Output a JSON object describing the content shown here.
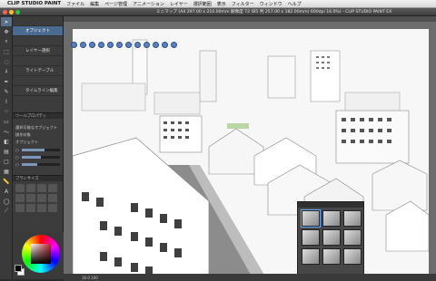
{
  "menubar": {
    "apple_glyph": "",
    "app_name": "CLIP STUDIO PAINT",
    "items": [
      "ファイル",
      "編集",
      "ページ管理",
      "アニメーション",
      "レイヤー",
      "選択範囲",
      "表示",
      "フィルター",
      "ウィンドウ",
      "ヘルプ"
    ]
  },
  "window": {
    "title": "ミニマップ (A4 297.00 x 210.00mm 解像度 72 (B5 判 257.00 x 182.00mm) 600dpi 16.0%) - CLIP STUDIO PAINT EX"
  },
  "sub_tools": {
    "items": [
      {
        "label": "",
        "selected": false
      },
      {
        "label": "オブジェクト",
        "selected": true
      },
      {
        "label": "",
        "selected": false
      },
      {
        "label": "レイヤー選択",
        "selected": false
      },
      {
        "label": "",
        "selected": false
      },
      {
        "label": "ライトテーブル",
        "selected": false
      },
      {
        "label": "",
        "selected": false
      },
      {
        "label": "タイムライン編集",
        "selected": false
      }
    ]
  },
  "tool_property": {
    "header": "ツールプロパティ",
    "rows": [
      {
        "label": "選択可能なオブジェクト",
        "level": 0.6
      },
      {
        "label": "操作対象",
        "level": 0.5
      },
      {
        "label": "オブジェクト",
        "level": 0.4
      }
    ]
  },
  "brush_size": {
    "header": "ブラシサイズ"
  },
  "colors": {
    "accent": "#4b6a90",
    "tool_selected": "#5a6f8a",
    "camera_btn": "#5a7ec0",
    "main_color": "#000000",
    "sub_color": "#ffffff",
    "traffic": [
      "#ff5f57",
      "#febc2e",
      "#28c840"
    ]
  },
  "status": {
    "text": "16.0 100"
  }
}
